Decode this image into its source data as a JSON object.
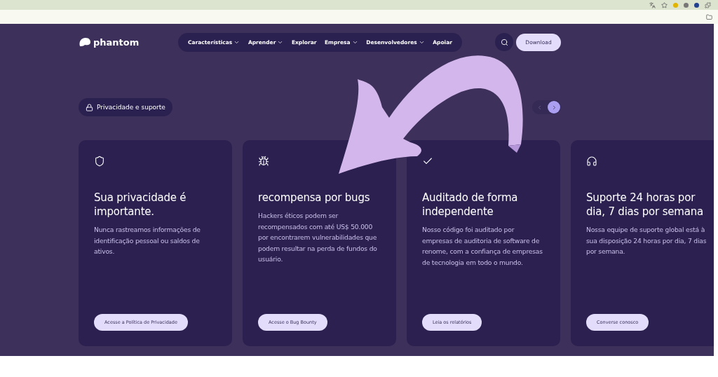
{
  "nav": {
    "logo": "phantom",
    "items": [
      {
        "label": "Características",
        "dropdown": true
      },
      {
        "label": "Aprender",
        "dropdown": true
      },
      {
        "label": "Explorar",
        "dropdown": false
      },
      {
        "label": "Empresa",
        "dropdown": true
      },
      {
        "label": "Desenvolvedores",
        "dropdown": true
      },
      {
        "label": "Apoiar",
        "dropdown": false
      }
    ],
    "download": "Download"
  },
  "section_chip": "Privacidade e suporte",
  "carousel": {
    "prev_disabled": true,
    "next_disabled": false
  },
  "cards": [
    {
      "kind": "shield",
      "title": "Sua privacidade é importante.",
      "text": "Nunca rastreamos informações de identificação pessoal ou saldos de ativos.",
      "button": "Acesse a Política de Privacidade"
    },
    {
      "kind": "bug",
      "title": "recompensa por bugs",
      "text": "Hackers éticos podem ser recompensados com até US$ 50.000 por encontrarem vulnerabilidades que podem resultar na perda de fundos do usuário.",
      "button": "Acesse o Bug Bounty"
    },
    {
      "kind": "check",
      "title": "Auditado de forma independente",
      "text": "Nosso código foi auditado por empresas de auditoria de software de renome, com a confiança de empresas de tecnologia em todo o mundo.",
      "button": "Leia os relatórios"
    },
    {
      "kind": "headphones",
      "title": "Suporte 24 horas por dia, 7 dias por semana",
      "text": "Nossa equipe de suporte global está à sua disposição 24 horas por dia, 7 dias por semana.",
      "button": "Converse conosco"
    }
  ]
}
